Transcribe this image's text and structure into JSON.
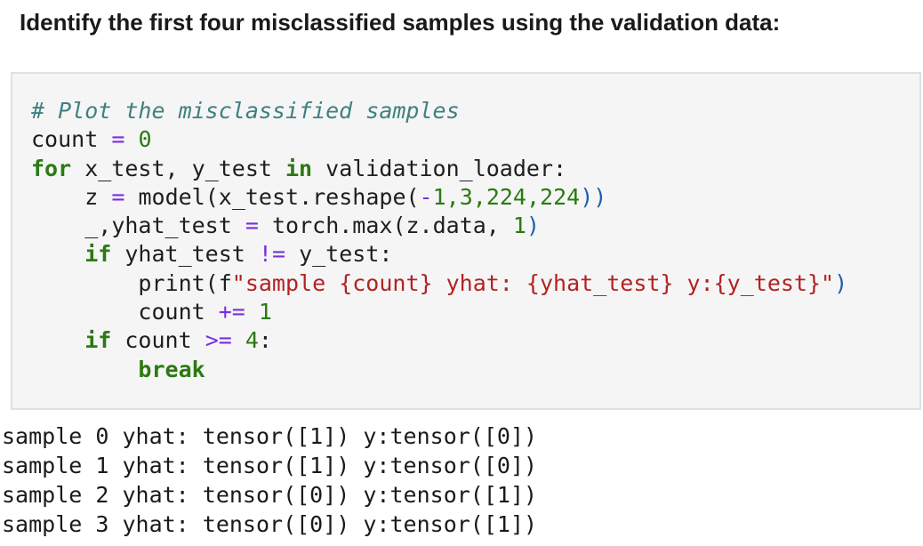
{
  "heading": "Identify the first four misclassified samples using the validation data:",
  "code": {
    "comment": "# Plot the misclassified samples",
    "count_var": "count",
    "assign": "=",
    "zero": "0",
    "kw_for": "for",
    "loop_vars": " x_test, y_test ",
    "kw_in": "in",
    "loader": " validation_loader:",
    "z_lhs": "z",
    "model_call": "model(x_test.reshape(",
    "reshape_minus": "-",
    "reshape_args": "1,3,224,224",
    "close_parens": "))",
    "max_lhs": "_,yhat_test",
    "torch_max": "torch.max(z.data, ",
    "one": "1",
    "close_paren": ")",
    "kw_if": "if",
    "cond_left": " yhat_test ",
    "neq": "!=",
    "cond_right": " y_test:",
    "print_open": "print(f",
    "fstring": "\"sample {count} yhat: {yhat_test} y:{y_test}\"",
    "print_close": ")",
    "count_inc_var": "count",
    "plus_eq": "+=",
    "count_inc_val": "1",
    "if_count": " count ",
    "gte": ">=",
    "four": "4",
    "colon": ":",
    "kw_break": "break"
  },
  "output": [
    "sample 0 yhat: tensor([1]) y:tensor([0])",
    "sample 1 yhat: tensor([1]) y:tensor([0])",
    "sample 2 yhat: tensor([0]) y:tensor([1])",
    "sample 3 yhat: tensor([0]) y:tensor([1])"
  ]
}
